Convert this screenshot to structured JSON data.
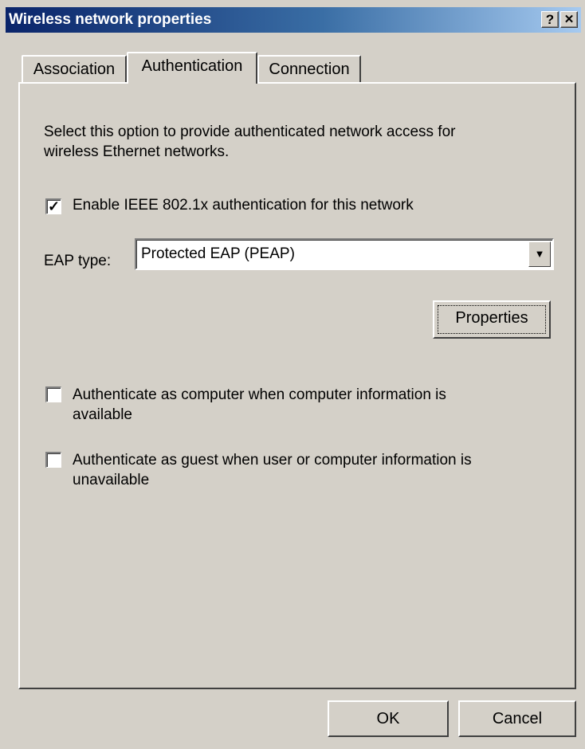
{
  "window": {
    "title": "Wireless network properties",
    "help_label": "?",
    "close_label": "✕"
  },
  "tabs": [
    {
      "label": "Association"
    },
    {
      "label": "Authentication"
    },
    {
      "label": "Connection"
    }
  ],
  "authentication": {
    "intro": "Select this option to provide authenticated network access for wireless Ethernet networks.",
    "intro_line1": "Select this option to provide authenticated network access for",
    "intro_line2": "wireless Ethernet networks.",
    "enable_8021x": {
      "label": "Enable IEEE 802.1x authentication for this network",
      "checked": true
    },
    "eap_type_label": "EAP type:",
    "eap_type_value": "Protected EAP (PEAP)",
    "properties_label": "Properties",
    "auth_as_computer": {
      "label_line1": "Authenticate as computer when computer information is",
      "label_line2": "available",
      "checked": false
    },
    "auth_as_guest": {
      "label_line1": "Authenticate as guest when user or computer information is",
      "label_line2": "unavailable",
      "checked": false
    }
  },
  "footer": {
    "ok_label": "OK",
    "cancel_label": "Cancel"
  },
  "colors": {
    "dialog_bg": "#d4d0c8",
    "title_gradient_start": "#0a246a",
    "title_gradient_end": "#a6caf0"
  }
}
